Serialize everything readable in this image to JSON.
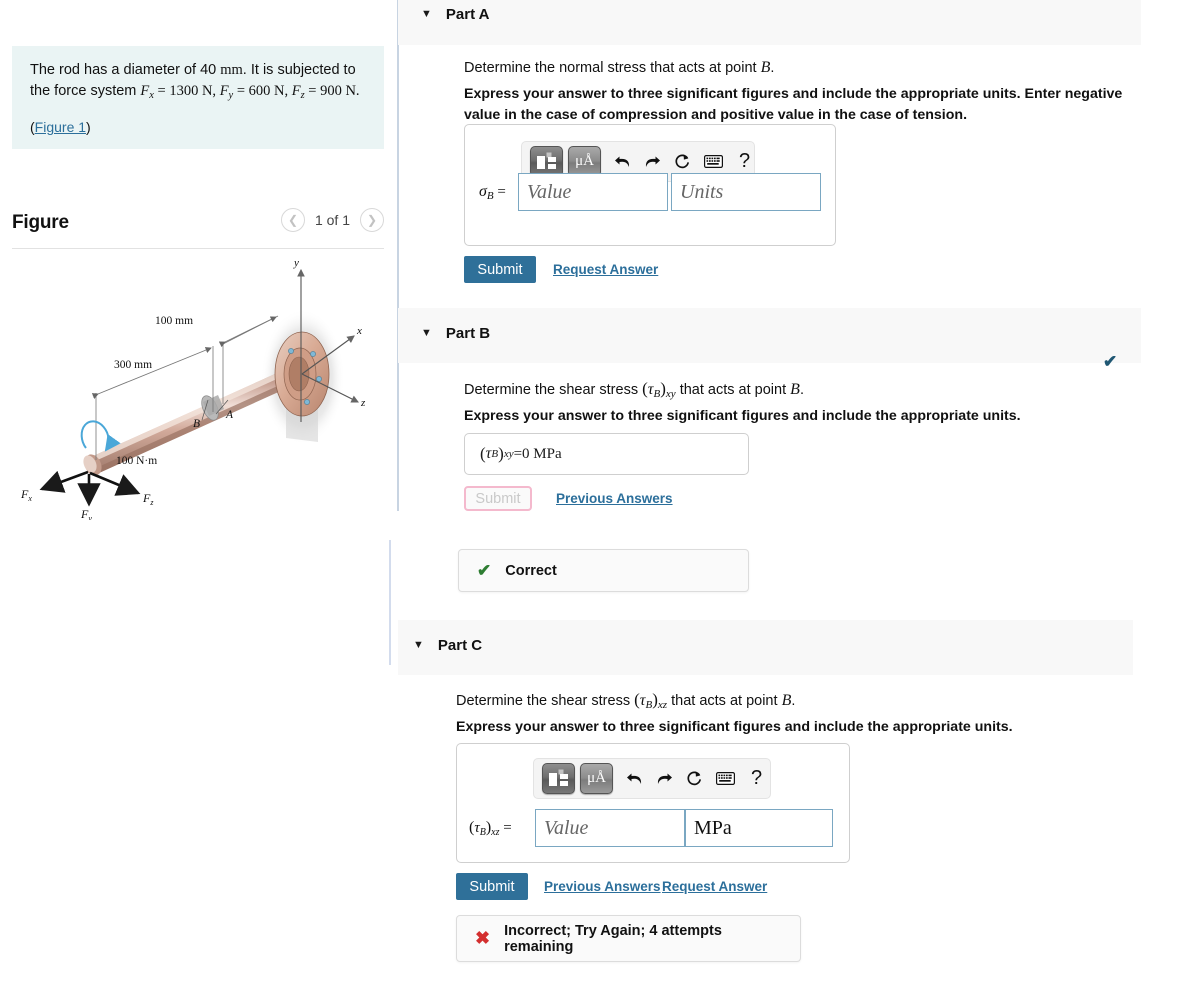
{
  "problem": {
    "line1_a": "The rod has a diameter of 40 ",
    "line1_unit": "mm",
    "line1_b": ". It is subjected to the force system ",
    "fx_sym": "F",
    "fx_sub": "x",
    "fx_val": " = 1300 N, ",
    "fy_sym": "F",
    "fy_sub": "y",
    "fy_val": " = 600 N, ",
    "fz_sym": "F",
    "fz_sub": "z",
    "fz_val": " = 900 N.",
    "figure_link": "Figure 1",
    "paren_open": "(",
    "paren_close": ")"
  },
  "figure": {
    "title": "Figure",
    "counter": "1 of 1",
    "prev_icon": "chevron-left-icon",
    "next_icon": "chevron-right-icon",
    "labels": {
      "axis_y": "y",
      "axis_x": "x",
      "axis_z": "z",
      "dim_100mm": "100 mm",
      "dim_300mm": "300 mm",
      "torque": "100 N·m",
      "point_a": "A",
      "point_b": "B",
      "force_x": "F",
      "force_x_sub": "x",
      "force_y": "F",
      "force_y_sub": "y",
      "force_z": "F",
      "force_z_sub": "z"
    }
  },
  "toolbar": {
    "template_icon": "math-template-icon",
    "units_label": "μÅ",
    "undo_icon": "undo-arrow-icon",
    "redo_icon": "redo-arrow-icon",
    "reset_icon": "reset-circle-icon",
    "keyboard_icon": "keyboard-icon",
    "help_label": "?"
  },
  "parts": {
    "a": {
      "caret": "▼",
      "label": "Part A",
      "question_pre": "Determine the normal stress that acts at point ",
      "question_sym": "B",
      "question_post": ".",
      "instruction": "Express your answer to three significant figures and include the appropriate units. Enter negative value in the case of compression and positive value in the case of tension.",
      "eq_sym": "σ",
      "eq_sub": "B",
      "eq_eq": " =",
      "value_placeholder": "Value",
      "units_placeholder": "Units",
      "submit_label": "Submit",
      "request_answer_label": "Request Answer"
    },
    "b": {
      "caret": "▼",
      "label": "Part B",
      "header_check": "✔",
      "question_pre": "Determine the shear stress ",
      "question_tau": "τ",
      "question_tau_sub": "B",
      "question_idx": "xy",
      "question_mid": " that acts at point ",
      "question_sym": "B",
      "question_post": ".",
      "instruction": "Express your answer to three significant figures and include the appropriate units.",
      "answer_tau": "τ",
      "answer_tau_sub": "B",
      "answer_idx": "xy",
      "answer_eq": " = ",
      "answer_value": "0 MPa",
      "submit_label": "Submit",
      "previous_answers_label": "Previous Answers",
      "feedback_icon": "check-icon",
      "feedback_text": "Correct",
      "feedback_color": "#2e7d32"
    },
    "c": {
      "caret": "▼",
      "label": "Part C",
      "question_pre": "Determine the shear stress ",
      "question_tau": "τ",
      "question_tau_sub": "B",
      "question_idx": "xz",
      "question_mid": " that acts at point ",
      "question_sym": "B",
      "question_post": ".",
      "instruction": "Express your answer to three significant figures and include the appropriate units.",
      "eq_tau": "τ",
      "eq_tau_sub": "B",
      "eq_idx": "xz",
      "eq_eq": " =",
      "value_placeholder": "Value",
      "units_value": "MPa",
      "submit_label": "Submit",
      "previous_answers_label": "Previous Answers",
      "request_answer_label": "Request Answer",
      "feedback_icon": "x-icon",
      "feedback_text": "Incorrect; Try Again; 4 attempts remaining",
      "feedback_color": "#d32f2f"
    }
  },
  "colors": {
    "accent": "#2f7099",
    "link": "#2c6f9b",
    "problem_bg": "#eaf4f4",
    "header_bg": "#f8f8f8",
    "correct_green": "#2e7d32",
    "incorrect_red": "#d32f2f",
    "disabled_pink": "#f4b9cd"
  }
}
